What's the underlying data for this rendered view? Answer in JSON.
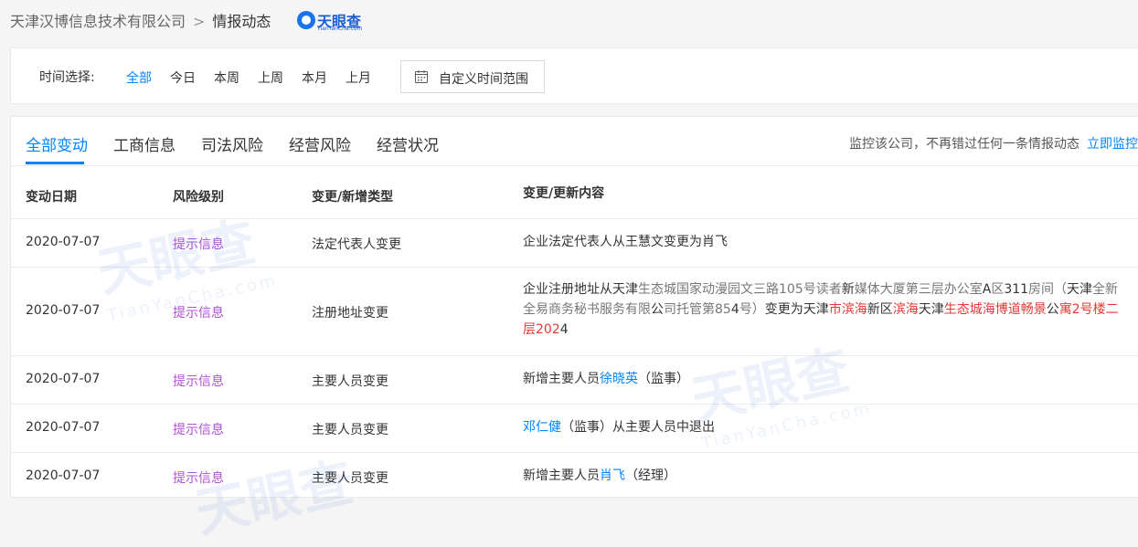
{
  "breadcrumb": {
    "company": "天津汉博信息技术有限公司",
    "separator": ">",
    "current": "情报动态"
  },
  "logo": {
    "name": "天眼查",
    "sub": "TianYanCha.com"
  },
  "filter": {
    "label": "时间选择:",
    "options": [
      "全部",
      "今日",
      "本周",
      "上周",
      "本月",
      "上月"
    ],
    "active": "全部",
    "custom_range": "自定义时间范围"
  },
  "tabs": {
    "items": [
      "全部变动",
      "工商信息",
      "司法风险",
      "经营风险",
      "经营状况"
    ],
    "active": "全部变动"
  },
  "monitor": {
    "text": "监控该公司，不再错过任何一条情报动态",
    "link": "立即监控"
  },
  "table": {
    "headers": [
      "变动日期",
      "风险级别",
      "变更/新增类型",
      "变更/更新内容"
    ],
    "rows": [
      {
        "date": "2020-07-07",
        "risk": "提示信息",
        "type": "法定代表人变更",
        "content": [
          {
            "text": "企业法定代表人从王慧文变更为肖飞",
            "style": "normal"
          }
        ]
      },
      {
        "date": "2020-07-07",
        "risk": "提示信息",
        "type": "注册地址变更",
        "content": [
          {
            "text": "企业注册地址从天津",
            "style": "normal"
          },
          {
            "text": "生态城国家动漫园文三路105号读者",
            "style": "gray"
          },
          {
            "text": "新",
            "style": "normal"
          },
          {
            "text": "媒体大厦第三层办公室",
            "style": "gray"
          },
          {
            "text": "A",
            "style": "normal"
          },
          {
            "text": "区",
            "style": "gray"
          },
          {
            "text": "311",
            "style": "normal"
          },
          {
            "text": "房间（",
            "style": "gray"
          },
          {
            "text": "天津",
            "style": "normal"
          },
          {
            "text": "全新全易商务秘书服务有限",
            "style": "gray"
          },
          {
            "text": "公",
            "style": "normal"
          },
          {
            "text": "司托管第85",
            "style": "gray"
          },
          {
            "text": "4",
            "style": "normal"
          },
          {
            "text": "号）",
            "style": "gray"
          },
          {
            "text": "变更为天津",
            "style": "normal"
          },
          {
            "text": "市滨海",
            "style": "red"
          },
          {
            "text": "新区",
            "style": "normal"
          },
          {
            "text": "滨海",
            "style": "red"
          },
          {
            "text": "天津",
            "style": "normal"
          },
          {
            "text": "生态城海博道畅景",
            "style": "red"
          },
          {
            "text": "公",
            "style": "normal"
          },
          {
            "text": "寓2号楼二层202",
            "style": "red"
          },
          {
            "text": "4",
            "style": "normal"
          }
        ]
      },
      {
        "date": "2020-07-07",
        "risk": "提示信息",
        "type": "主要人员变更",
        "content": [
          {
            "text": "新增主要人员",
            "style": "normal"
          },
          {
            "text": "徐晓英",
            "style": "link"
          },
          {
            "text": "（监事）",
            "style": "normal"
          }
        ]
      },
      {
        "date": "2020-07-07",
        "risk": "提示信息",
        "type": "主要人员变更",
        "content": [
          {
            "text": "邓仁健",
            "style": "link"
          },
          {
            "text": "（监事）从主要人员中退出",
            "style": "normal"
          }
        ]
      },
      {
        "date": "2020-07-07",
        "risk": "提示信息",
        "type": "主要人员变更",
        "content": [
          {
            "text": "新增主要人员",
            "style": "normal"
          },
          {
            "text": "肖飞",
            "style": "link"
          },
          {
            "text": "（经理）",
            "style": "normal"
          }
        ]
      }
    ]
  },
  "watermark": {
    "big": "天眼查",
    "small": "TianYanCha.com"
  },
  "colors": {
    "accent": "#0084ff",
    "risk": "#b052d6",
    "highlight": "#e53935",
    "brand": "#1a5fd4"
  }
}
